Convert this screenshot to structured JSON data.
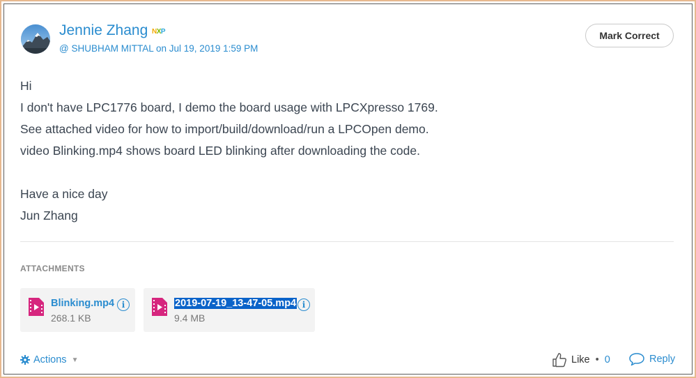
{
  "post": {
    "author_name": "Jennie Zhang",
    "badge": "NXP",
    "reply_to": "@ SHUBHAM MITTAL",
    "date_prefix": "on",
    "date": "Jul 19, 2019 1:59 PM",
    "mark_correct_label": "Mark Correct",
    "body_lines": [
      "Hi",
      "I don't have LPC1776 board, I demo the board usage with LPCXpresso 1769.",
      "See attached video for how to import/build/download/run a LPCOpen demo.",
      "video Blinking.mp4 shows board LED blinking after downloading the code.",
      "",
      "Have a nice day",
      "Jun Zhang"
    ]
  },
  "attachments": {
    "heading": "ATTACHMENTS",
    "items": [
      {
        "name": "Blinking.mp4",
        "size": "268.1 KB",
        "selected": false
      },
      {
        "name": "2019-07-19_13-47-05.mp4",
        "size": "9.4 MB",
        "selected": true
      }
    ]
  },
  "footer": {
    "actions_label": "Actions",
    "like_label": "Like",
    "like_separator": "•",
    "like_count": "0",
    "reply_label": "Reply"
  },
  "colors": {
    "link": "#2a8ccf",
    "file_icon": "#d6267e",
    "selection": "#0a63c9"
  }
}
